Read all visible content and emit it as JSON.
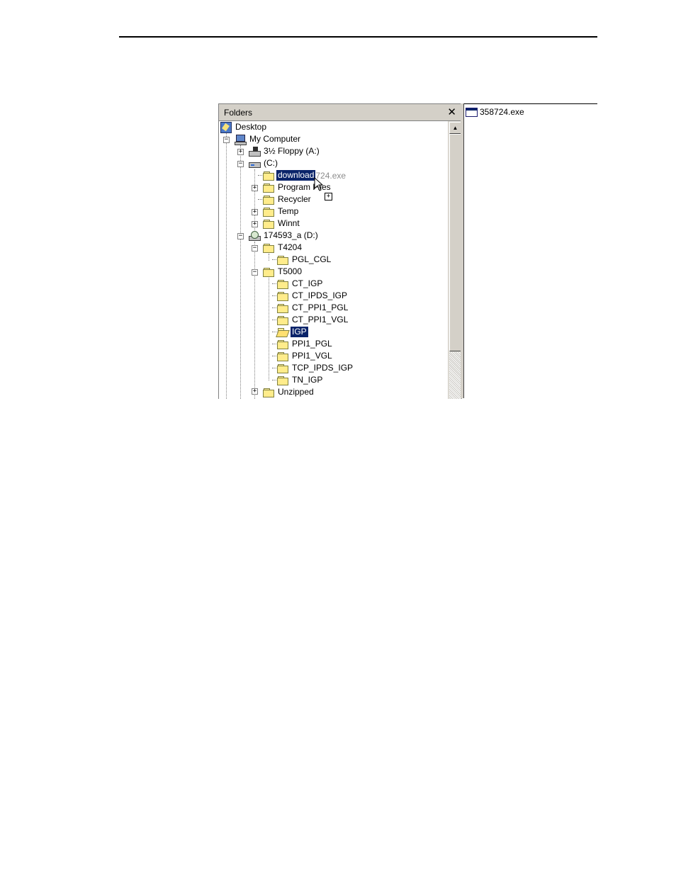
{
  "folders_pane": {
    "title": "Folders",
    "close_glyph": "✕"
  },
  "tree": {
    "desktop": "Desktop",
    "my_computer": "My Computer",
    "floppy": "3½ Floppy (A:)",
    "drive_c": "(C:)",
    "download_sel": "down",
    "download_rest": "load",
    "drag_ghost": "724.exe",
    "program_files": "Program Files",
    "recycler": "Recycler",
    "temp": "Temp",
    "winnt": "Winnt",
    "drive_d": "174593_a (D:)",
    "t4204": "T4204",
    "pgl_cgl": "PGL_CGL",
    "t5000": "T5000",
    "ct_igp": "CT_IGP",
    "ct_ipds_igp": "CT_IPDS_IGP",
    "ct_ppi1_pgl": "CT_PPI1_PGL",
    "ct_ppi1_vgl": "CT_PPI1_VGL",
    "igp": "IGP",
    "ppi1_pgl": "PPI1_PGL",
    "ppi1_vgl": "PPI1_VGL",
    "tcp_ipds_igp": "TCP_IPDS_IGP",
    "tn_igp": "TN_IGP",
    "unzipped": "Unzipped"
  },
  "expanders": {
    "plus": "+",
    "minus": "−"
  },
  "right_pane": {
    "file_name": "358724.exe"
  },
  "drag": {
    "plus_badge": "+"
  },
  "scrollbar": {
    "up_arrow": "▲"
  },
  "colors": {
    "selection": "#0a246a",
    "folder": "#ffec8b",
    "chrome": "#d4d0c8"
  }
}
